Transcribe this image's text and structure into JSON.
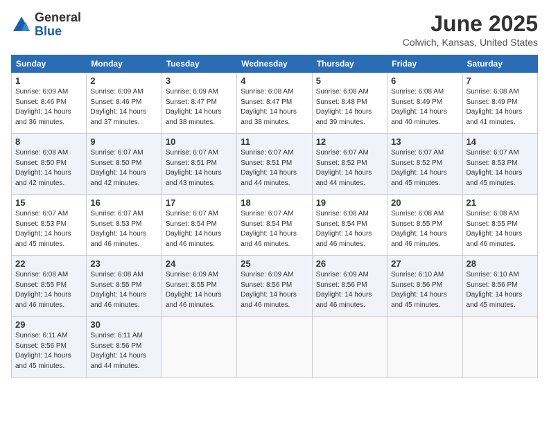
{
  "header": {
    "logo_line1": "General",
    "logo_line2": "Blue",
    "month": "June 2025",
    "location": "Colwich, Kansas, United States"
  },
  "weekdays": [
    "Sunday",
    "Monday",
    "Tuesday",
    "Wednesday",
    "Thursday",
    "Friday",
    "Saturday"
  ],
  "weeks": [
    [
      {
        "day": "1",
        "sunrise": "6:09 AM",
        "sunset": "8:46 PM",
        "daylight": "14 hours and 36 minutes."
      },
      {
        "day": "2",
        "sunrise": "6:09 AM",
        "sunset": "8:46 PM",
        "daylight": "14 hours and 37 minutes."
      },
      {
        "day": "3",
        "sunrise": "6:09 AM",
        "sunset": "8:47 PM",
        "daylight": "14 hours and 38 minutes."
      },
      {
        "day": "4",
        "sunrise": "6:08 AM",
        "sunset": "8:47 PM",
        "daylight": "14 hours and 38 minutes."
      },
      {
        "day": "5",
        "sunrise": "6:08 AM",
        "sunset": "8:48 PM",
        "daylight": "14 hours and 39 minutes."
      },
      {
        "day": "6",
        "sunrise": "6:08 AM",
        "sunset": "8:49 PM",
        "daylight": "14 hours and 40 minutes."
      },
      {
        "day": "7",
        "sunrise": "6:08 AM",
        "sunset": "8:49 PM",
        "daylight": "14 hours and 41 minutes."
      }
    ],
    [
      {
        "day": "8",
        "sunrise": "6:08 AM",
        "sunset": "8:50 PM",
        "daylight": "14 hours and 42 minutes."
      },
      {
        "day": "9",
        "sunrise": "6:07 AM",
        "sunset": "8:50 PM",
        "daylight": "14 hours and 42 minutes."
      },
      {
        "day": "10",
        "sunrise": "6:07 AM",
        "sunset": "8:51 PM",
        "daylight": "14 hours and 43 minutes."
      },
      {
        "day": "11",
        "sunrise": "6:07 AM",
        "sunset": "8:51 PM",
        "daylight": "14 hours and 44 minutes."
      },
      {
        "day": "12",
        "sunrise": "6:07 AM",
        "sunset": "8:52 PM",
        "daylight": "14 hours and 44 minutes."
      },
      {
        "day": "13",
        "sunrise": "6:07 AM",
        "sunset": "8:52 PM",
        "daylight": "14 hours and 45 minutes."
      },
      {
        "day": "14",
        "sunrise": "6:07 AM",
        "sunset": "8:53 PM",
        "daylight": "14 hours and 45 minutes."
      }
    ],
    [
      {
        "day": "15",
        "sunrise": "6:07 AM",
        "sunset": "8:53 PM",
        "daylight": "14 hours and 45 minutes."
      },
      {
        "day": "16",
        "sunrise": "6:07 AM",
        "sunset": "8:53 PM",
        "daylight": "14 hours and 46 minutes."
      },
      {
        "day": "17",
        "sunrise": "6:07 AM",
        "sunset": "8:54 PM",
        "daylight": "14 hours and 46 minutes."
      },
      {
        "day": "18",
        "sunrise": "6:07 AM",
        "sunset": "8:54 PM",
        "daylight": "14 hours and 46 minutes."
      },
      {
        "day": "19",
        "sunrise": "6:08 AM",
        "sunset": "8:54 PM",
        "daylight": "14 hours and 46 minutes."
      },
      {
        "day": "20",
        "sunrise": "6:08 AM",
        "sunset": "8:55 PM",
        "daylight": "14 hours and 46 minutes."
      },
      {
        "day": "21",
        "sunrise": "6:08 AM",
        "sunset": "8:55 PM",
        "daylight": "14 hours and 46 minutes."
      }
    ],
    [
      {
        "day": "22",
        "sunrise": "6:08 AM",
        "sunset": "8:55 PM",
        "daylight": "14 hours and 46 minutes."
      },
      {
        "day": "23",
        "sunrise": "6:08 AM",
        "sunset": "8:55 PM",
        "daylight": "14 hours and 46 minutes."
      },
      {
        "day": "24",
        "sunrise": "6:09 AM",
        "sunset": "8:55 PM",
        "daylight": "14 hours and 46 minutes."
      },
      {
        "day": "25",
        "sunrise": "6:09 AM",
        "sunset": "8:56 PM",
        "daylight": "14 hours and 46 minutes."
      },
      {
        "day": "26",
        "sunrise": "6:09 AM",
        "sunset": "8:56 PM",
        "daylight": "14 hours and 46 minutes."
      },
      {
        "day": "27",
        "sunrise": "6:10 AM",
        "sunset": "8:56 PM",
        "daylight": "14 hours and 45 minutes."
      },
      {
        "day": "28",
        "sunrise": "6:10 AM",
        "sunset": "8:56 PM",
        "daylight": "14 hours and 45 minutes."
      }
    ],
    [
      {
        "day": "29",
        "sunrise": "6:11 AM",
        "sunset": "8:56 PM",
        "daylight": "14 hours and 45 minutes."
      },
      {
        "day": "30",
        "sunrise": "6:11 AM",
        "sunset": "8:56 PM",
        "daylight": "14 hours and 44 minutes."
      },
      null,
      null,
      null,
      null,
      null
    ]
  ]
}
